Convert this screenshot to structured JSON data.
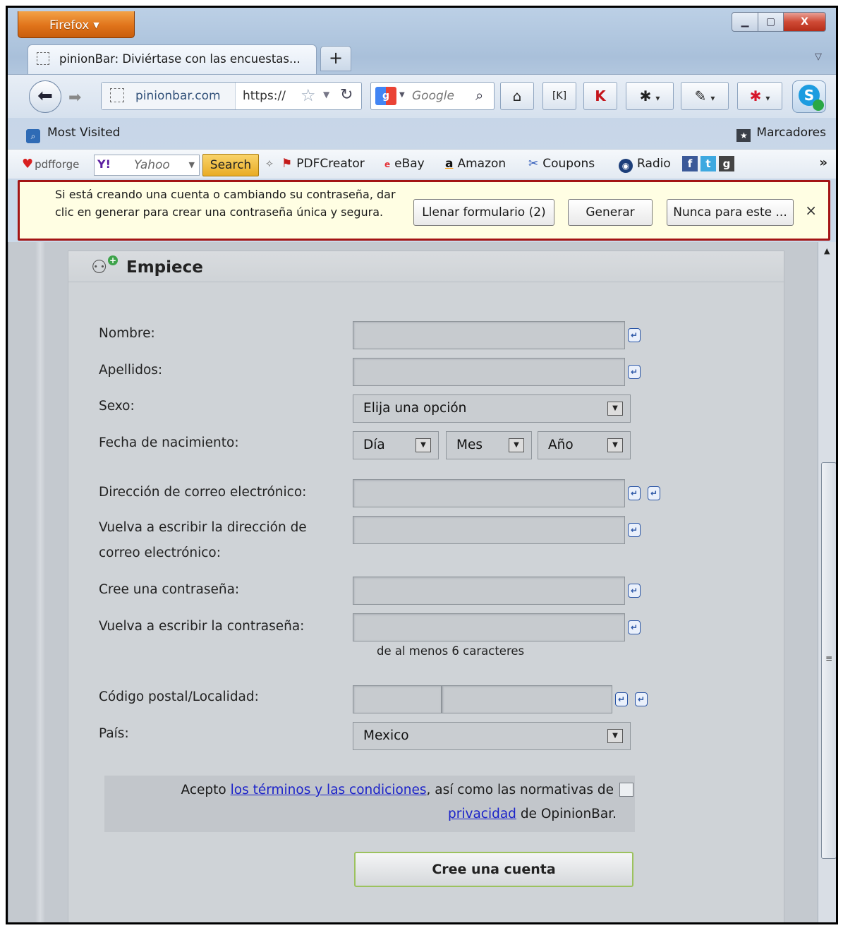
{
  "window": {
    "app_menu_label": "Firefox",
    "controls": {
      "minimize": "▁",
      "maximize": "▢",
      "close": "X"
    }
  },
  "tabs": [
    {
      "title": "pinionBar: Diviértase con las encuestas..."
    }
  ],
  "new_tab_label": "+",
  "navbar": {
    "site_identity": "pinionbar.com",
    "url": "https://",
    "search_engine": "Google"
  },
  "bookmarks": {
    "most_visited": "Most Visited",
    "bookmarks_menu": "Marcadores"
  },
  "addon_toolbar": {
    "pdfforge": "pdfforge",
    "yahoo_placeholder": "Yahoo",
    "yahoo_logo": "Y!",
    "search_button": "Search",
    "links": [
      {
        "label": "PDFCreator"
      },
      {
        "label": "eBay"
      },
      {
        "label": "Amazon"
      },
      {
        "label": "Coupons"
      },
      {
        "label": "Radio"
      }
    ]
  },
  "notification": {
    "message": "Si está creando una cuenta o cambiando su contraseña, dar clic en generar para crear una contraseña única y segura.",
    "fill_button": "Llenar formulario (2)",
    "generate_button": "Generar",
    "never_button": "Nunca para este ...",
    "close": "×"
  },
  "form": {
    "title": "Empiece",
    "labels": {
      "first_name": "Nombre:",
      "last_name": "Apellidos:",
      "sex": "Sexo:",
      "birth_date": "Fecha de nacimiento:",
      "email": "Dirección de correo electrónico:",
      "email_confirm_1": "Vuelva a escribir la dirección de",
      "email_confirm_2": "correo electrónico:",
      "password": "Cree una contraseña:",
      "password_confirm": "Vuelva a escribir la contraseña:",
      "postal": "Código postal/Localidad:",
      "country": "País:"
    },
    "values": {
      "sex": "Elija una opción",
      "day": "Día",
      "month": "Mes",
      "year": "Año",
      "country": "Mexico"
    },
    "password_hint": "de al menos 6 caracteres",
    "terms": {
      "prefix": "Acepto ",
      "link_terms": "los términos y las condiciones",
      "middle": ", así como las normativas de",
      "link_privacy": "privacidad",
      "suffix": " de OpinionBar."
    },
    "submit": "Cree una cuenta"
  }
}
